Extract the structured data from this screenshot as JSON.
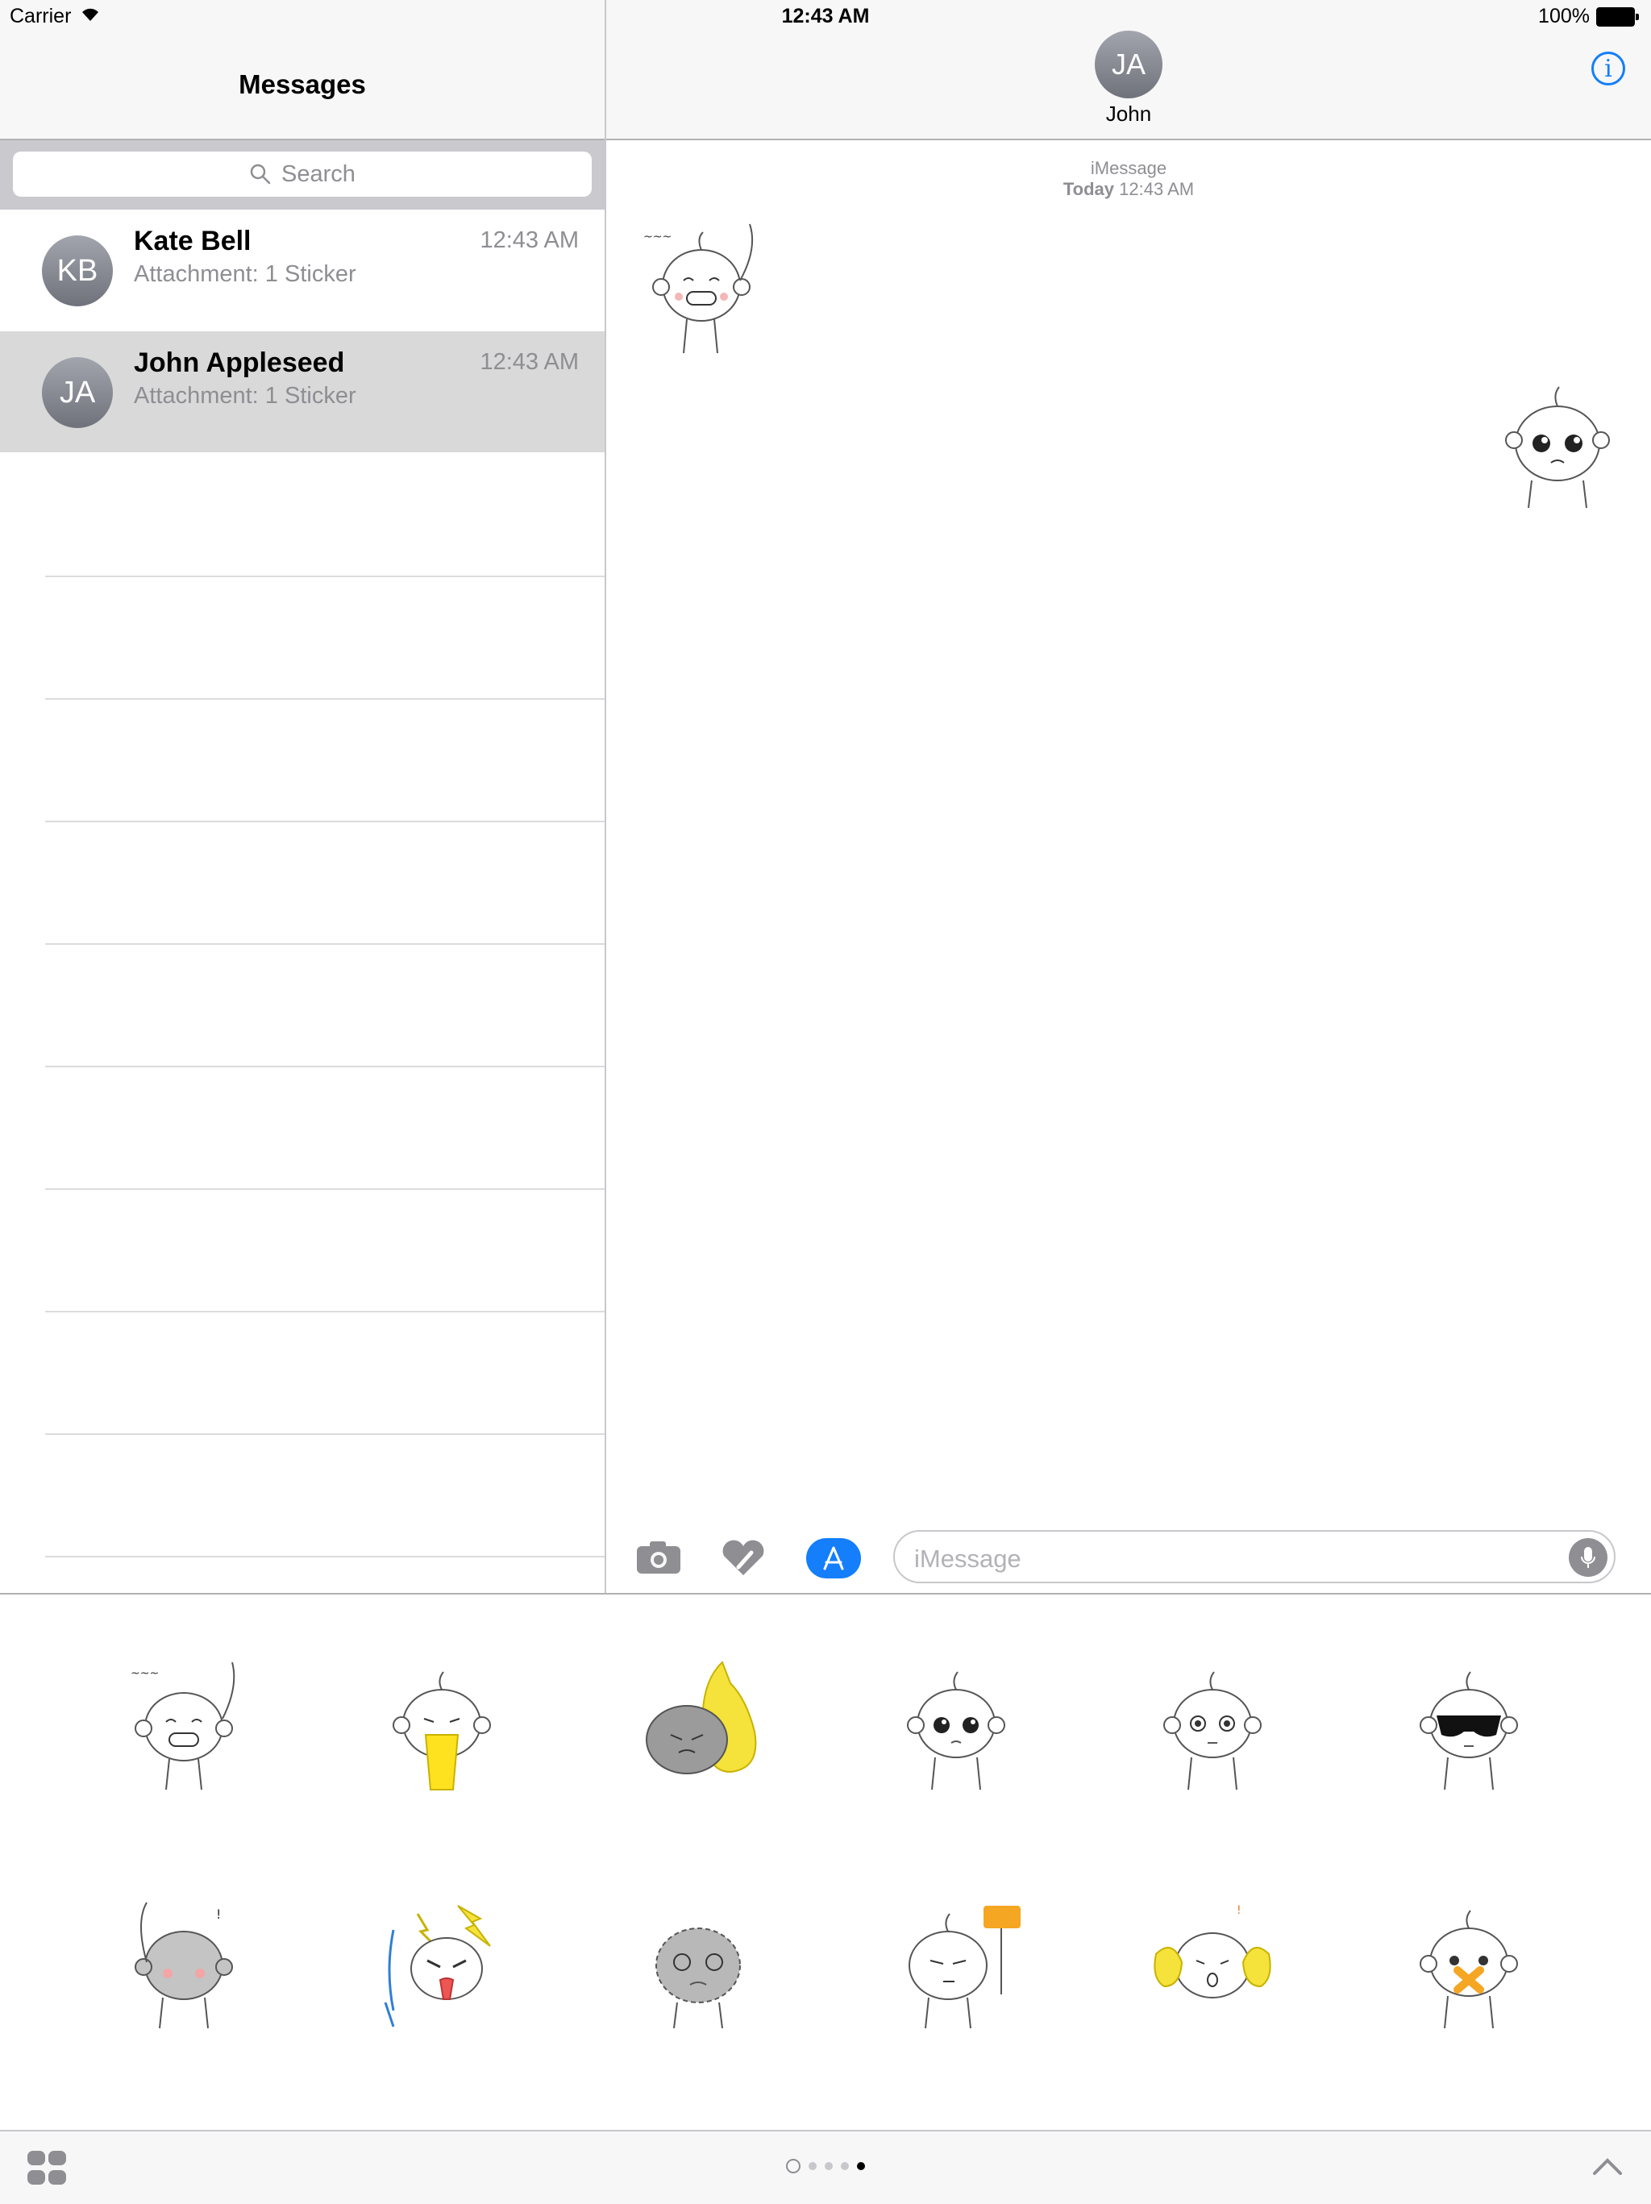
{
  "status": {
    "carrier": "Carrier",
    "time": "12:43 AM",
    "battery": "100%"
  },
  "left": {
    "title": "Messages",
    "search_placeholder": "Search",
    "conversations": [
      {
        "initials": "KB",
        "name": "Kate Bell",
        "preview": "Attachment: 1 Sticker",
        "time": "12:43 AM",
        "selected": false
      },
      {
        "initials": "JA",
        "name": "John Appleseed",
        "preview": "Attachment: 1 Sticker",
        "time": "12:43 AM",
        "selected": true
      }
    ]
  },
  "right": {
    "contact_initials": "JA",
    "contact_name": "John",
    "info_label": "i",
    "service": "iMessage",
    "date_day": "Today",
    "date_time": "12:43 AM",
    "compose_placeholder": "iMessage"
  },
  "drawer": {
    "stickers": [
      "monkey-grin-sticker",
      "monkey-tongue-sticker",
      "monkey-pear-sticker",
      "monkey-teary-sticker",
      "monkey-worried-sticker",
      "monkey-sunglasses-sticker",
      "monkey-blush-sticker",
      "monkey-angry-sticker",
      "monkey-dizzy-sticker",
      "monkey-sign-sticker",
      "monkey-cheer-sticker",
      "monkey-taped-mouth-sticker"
    ],
    "page_count": 4,
    "active_page": 4
  },
  "colors": {
    "accent": "#147efb",
    "selected_row": "#d9d9d9",
    "secondary_text": "#8e8e93"
  }
}
